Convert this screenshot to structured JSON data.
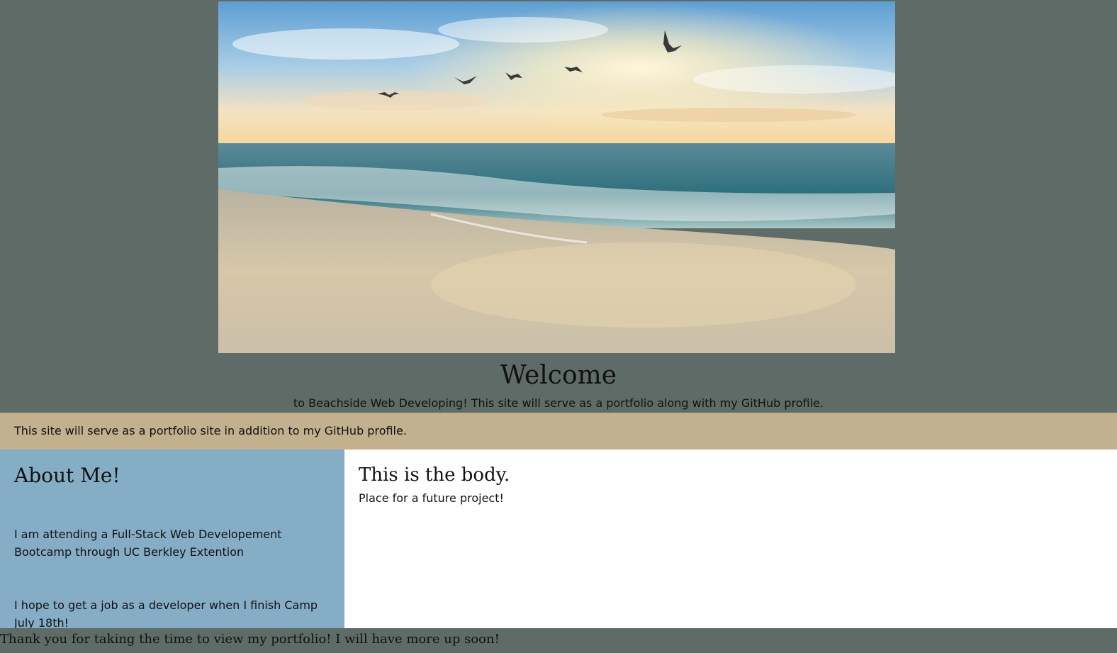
{
  "header": {
    "title": "Welcome",
    "tagline": "to Beachside Web Developing! This site will serve as a portfolio along with my GitHub profile."
  },
  "banner": {
    "text": "This site will serve as a portfolio site in addition to my GitHub profile."
  },
  "aside": {
    "heading": "About Me!",
    "paragraphs": [
      "I am attending a Full-Stack Web Developement Bootcamp through UC Berkley Extention",
      "I hope to get a job as a developer when I finish Camp July 18th!"
    ]
  },
  "main": {
    "heading": "This is the body.",
    "text": "Place for a future project!"
  },
  "footer": {
    "text": "Thank you for taking the time to view my portfolio! I will have more up soon!"
  },
  "colors": {
    "page_background": "#5f6b66",
    "banner_background": "#c2b08f",
    "aside_background": "#86adc6",
    "main_background": "#ffffff"
  },
  "images": {
    "hero": "beach-sunrise-with-seagulls-image"
  }
}
